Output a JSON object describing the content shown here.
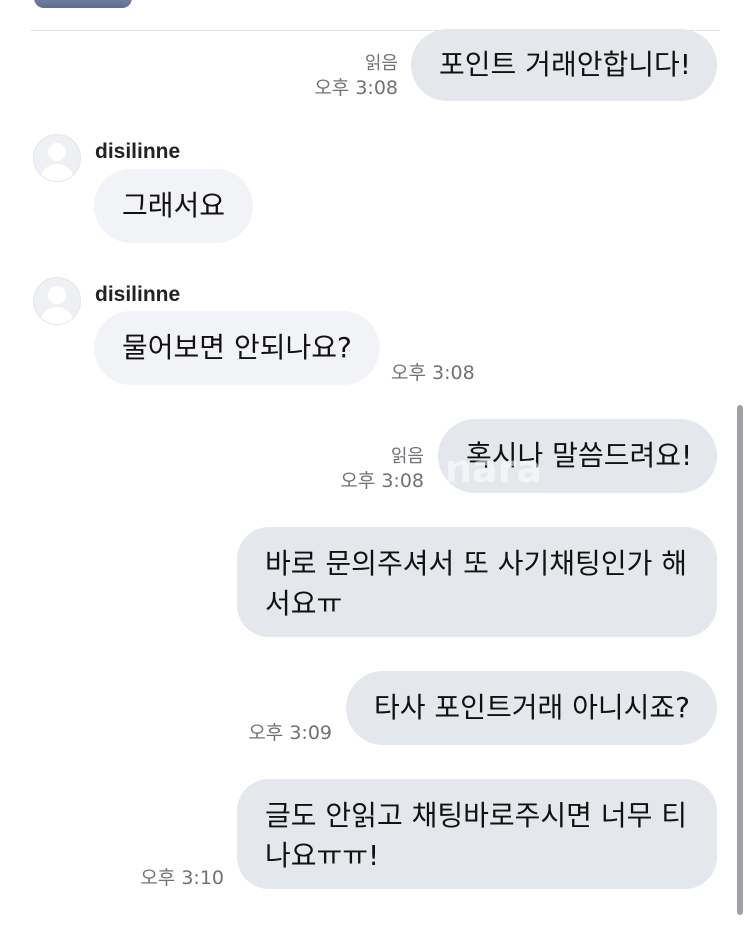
{
  "messages": [
    {
      "direction": "out",
      "text": "포인트 거래안합니다!",
      "read": "읽음",
      "time": "오후 3:08"
    },
    {
      "direction": "in",
      "sender": "disilinne",
      "text": "그래서요"
    },
    {
      "direction": "in",
      "sender": "disilinne",
      "text": "물어보면 안되나요?",
      "time": "오후 3:08"
    },
    {
      "direction": "out",
      "text": "혹시나 말씀드려요!",
      "read": "읽음",
      "time": "오후 3:08"
    },
    {
      "direction": "out",
      "text": "바로 문의주셔서 또 사기채팅인가 해서요ㅠ"
    },
    {
      "direction": "out",
      "text": "타사 포인트거래 아니시죠?",
      "time": "오후 3:09"
    },
    {
      "direction": "out",
      "text": "글도 안읽고 채팅바로주시면 너무 티나요ㅠㅠ!",
      "time": "오후 3:10"
    }
  ],
  "watermark": "nara"
}
